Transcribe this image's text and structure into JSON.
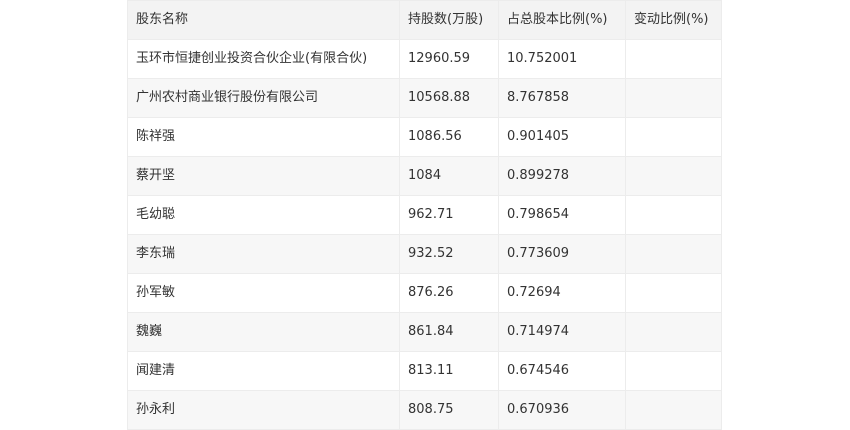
{
  "table": {
    "headers": [
      "股东名称",
      "持股数(万股)",
      "占总股本比例(%)",
      "变动比例(%)"
    ],
    "rows": [
      [
        "玉环市恒捷创业投资合伙企业(有限合伙)",
        "12960.59",
        "10.752001",
        ""
      ],
      [
        "广州农村商业银行股份有限公司",
        "10568.88",
        "8.767858",
        ""
      ],
      [
        "陈祥强",
        "1086.56",
        "0.901405",
        ""
      ],
      [
        "蔡开坚",
        "1084",
        "0.899278",
        ""
      ],
      [
        "毛幼聪",
        "962.71",
        "0.798654",
        ""
      ],
      [
        "李东瑞",
        "932.52",
        "0.773609",
        ""
      ],
      [
        "孙军敏",
        "876.26",
        "0.72694",
        ""
      ],
      [
        "魏巍",
        "861.84",
        "0.714974",
        ""
      ],
      [
        "闻建清",
        "813.11",
        "0.674546",
        ""
      ],
      [
        "孙永利",
        "808.75",
        "0.670936",
        ""
      ]
    ]
  }
}
